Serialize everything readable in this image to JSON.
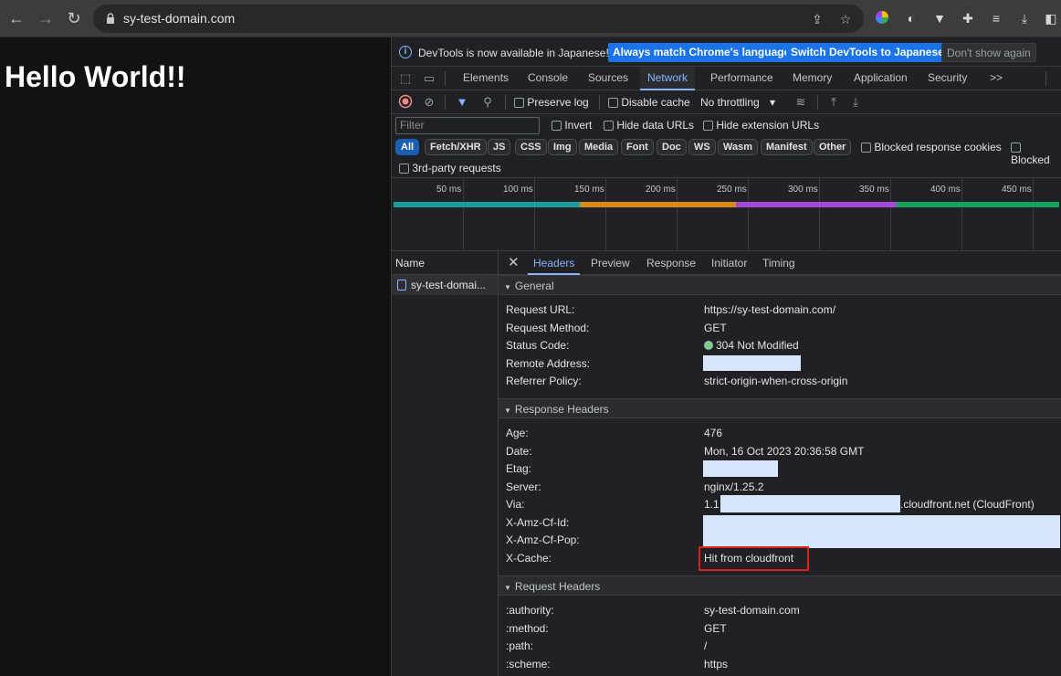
{
  "browser": {
    "url": "sy-test-domain.com",
    "icons": [
      "back-icon",
      "forward-icon",
      "reload-icon",
      "lock-icon",
      "share-icon",
      "star-icon",
      "extension-color-icon",
      "extension-circle-icon",
      "extension-v-icon",
      "puzzle-icon",
      "media-icon",
      "download-icon",
      "sidepanel-icon"
    ]
  },
  "page": {
    "heading": "Hello World!!"
  },
  "devtools": {
    "infobar": {
      "message": "DevTools is now available in Japanese!",
      "btn_match": "Always match Chrome's language",
      "btn_switch": "Switch DevTools to Japanese",
      "btn_dismiss": "Don't show again"
    },
    "tabs": [
      "Elements",
      "Console",
      "Sources",
      "Network",
      "Performance",
      "Memory",
      "Application",
      "Security"
    ],
    "more_tabs": ">>",
    "active_tab": "Network",
    "toolbar": {
      "preserve_log": "Preserve log",
      "disable_cache": "Disable cache",
      "throttling": "No throttling"
    },
    "filter": {
      "placeholder": "Filter",
      "invert": "Invert",
      "hide_data": "Hide data URLs",
      "hide_ext": "Hide extension URLs"
    },
    "types": [
      "All",
      "Fetch/XHR",
      "JS",
      "CSS",
      "Img",
      "Media",
      "Font",
      "Doc",
      "WS",
      "Wasm",
      "Manifest",
      "Other"
    ],
    "blocked_cookies": "Blocked response cookies",
    "blocked_req": "Blocked",
    "third_party": "3rd-party requests",
    "timeline_ticks": [
      "50 ms",
      "100 ms",
      "150 ms",
      "200 ms",
      "250 ms",
      "300 ms",
      "350 ms",
      "400 ms",
      "450 ms"
    ],
    "timeline_colors": {
      "teal": "#1a9ea0",
      "orange": "#d68b1a",
      "purple": "#a64ad6",
      "green": "#17a05d"
    },
    "name_header": "Name",
    "request_name": "sy-test-domai...",
    "detail_tabs": [
      "Headers",
      "Preview",
      "Response",
      "Initiator",
      "Timing"
    ],
    "general": {
      "title": "General",
      "rows": [
        {
          "k": "Request URL:",
          "v": "https://sy-test-domain.com/"
        },
        {
          "k": "Request Method:",
          "v": "GET"
        },
        {
          "k": "Status Code:",
          "v": "304 Not Modified"
        },
        {
          "k": "Remote Address:",
          "v": ""
        },
        {
          "k": "Referrer Policy:",
          "v": "strict-origin-when-cross-origin"
        }
      ]
    },
    "response": {
      "title": "Response Headers",
      "rows": [
        {
          "k": "Age:",
          "v": "476"
        },
        {
          "k": "Date:",
          "v": "Mon, 16 Oct 2023 20:36:58 GMT"
        },
        {
          "k": "Etag:",
          "v": ""
        },
        {
          "k": "Server:",
          "v": "nginx/1.25.2"
        },
        {
          "k": "Via:",
          "v": "1.1",
          "v2": ".cloudfront.net (CloudFront)"
        },
        {
          "k": "X-Amz-Cf-Id:",
          "v": ""
        },
        {
          "k": "X-Amz-Cf-Pop:",
          "v": ""
        },
        {
          "k": "X-Cache:",
          "v": "Hit from cloudfront"
        }
      ]
    },
    "request": {
      "title": "Request Headers",
      "rows": [
        {
          "k": ":authority:",
          "v": "sy-test-domain.com"
        },
        {
          "k": ":method:",
          "v": "GET"
        },
        {
          "k": ":path:",
          "v": "/"
        },
        {
          "k": ":scheme:",
          "v": "https"
        }
      ]
    }
  }
}
